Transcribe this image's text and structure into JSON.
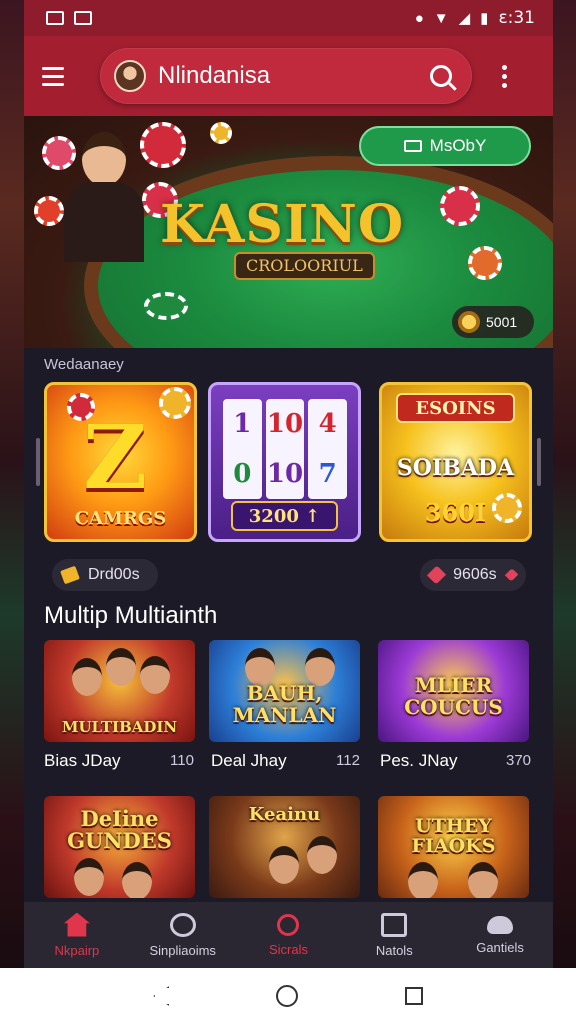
{
  "status_bar": {
    "time": "ε:31"
  },
  "app_bar": {
    "search_text": "Nlindanisa"
  },
  "hero": {
    "title": "KASINO",
    "subtitle": "CROLOORIUL",
    "play_button": "MsObY",
    "coins": "5001"
  },
  "featured": {
    "label": "Wedaanaey",
    "tiles": [
      {
        "big": "Z",
        "caption": "CAMRGS"
      },
      {
        "reels": [
          "1",
          "10",
          "4",
          "0",
          "10",
          "7"
        ],
        "caption": "3200 ↑"
      },
      {
        "top": "ESOINS",
        "mid": "SOIBADA",
        "caption": "360I"
      }
    ],
    "pill_left": "Drd00s",
    "pill_right": "9606s"
  },
  "multiplayer": {
    "title": "Multip Multiainth",
    "cards": [
      {
        "art": "MULTIBADIN",
        "label": "Bias JDay",
        "num": "110"
      },
      {
        "art": "BAUH,\nMANLAN",
        "label": "Deal Jhay",
        "num": "112"
      },
      {
        "art": "MLIER\nCOUCUS",
        "label": "Pes. JNay",
        "num": "370"
      },
      {
        "art": "DeIine\nGUNDES",
        "label": "",
        "num": ""
      },
      {
        "art": "Keainu",
        "label": "",
        "num": ""
      },
      {
        "art": "UTHEY\nFIAOKS",
        "label": "",
        "num": ""
      }
    ]
  },
  "bottom_nav": {
    "items": [
      {
        "label": "Nkpairp",
        "icon": "home-icon"
      },
      {
        "label": "Sinpliaoims",
        "icon": "chat-icon"
      },
      {
        "label": "Sicrals",
        "icon": "search-icon"
      },
      {
        "label": "Natols",
        "icon": "news-icon"
      },
      {
        "label": "Gantiels",
        "icon": "cloud-icon"
      }
    ]
  },
  "colors": {
    "accent": "#a31f30",
    "active": "#e0354a",
    "green": "#1f9a4b"
  }
}
